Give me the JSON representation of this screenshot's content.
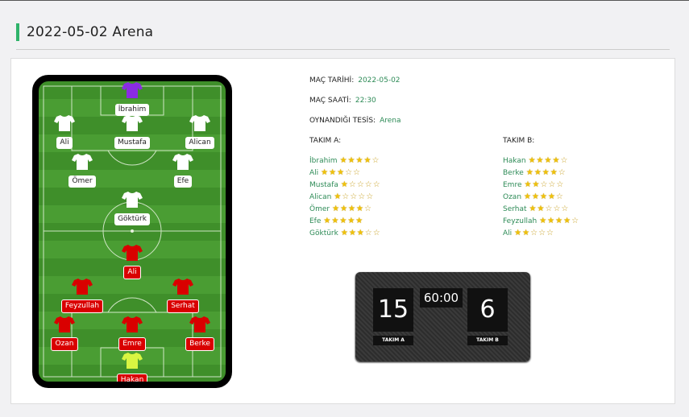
{
  "page": {
    "title": "2022-05-02 Arena"
  },
  "match": {
    "date_label": "MAÇ TARİHİ:",
    "date_value": "2022-05-02",
    "time_label": "MAÇ SAATİ:",
    "time_value": "22:30",
    "venue_label": "OYNANDIĞI TESİS:",
    "venue_value": "Arena"
  },
  "team_a": {
    "header": "TAKIM A:",
    "players": [
      {
        "name": "İbrahim",
        "rating": 4
      },
      {
        "name": "Ali",
        "rating": 3
      },
      {
        "name": "Mustafa",
        "rating": 1
      },
      {
        "name": "Alican",
        "rating": 1
      },
      {
        "name": "Ömer",
        "rating": 4
      },
      {
        "name": "Efe",
        "rating": 5
      },
      {
        "name": "Göktürk",
        "rating": 3
      }
    ]
  },
  "team_b": {
    "header": "TAKIM B:",
    "players": [
      {
        "name": "Hakan",
        "rating": 4
      },
      {
        "name": "Berke",
        "rating": 4
      },
      {
        "name": "Emre",
        "rating": 2
      },
      {
        "name": "Ozan",
        "rating": 4
      },
      {
        "name": "Serhat",
        "rating": 2
      },
      {
        "name": "Feyzullah",
        "rating": 4
      },
      {
        "name": "Ali",
        "rating": 2
      }
    ]
  },
  "pitch": {
    "top_players": [
      "İbrahim",
      "Ali",
      "Mustafa",
      "Alican",
      "Ömer",
      "Efe",
      "Göktürk"
    ],
    "bottom_players": [
      "Ali",
      "Feyzullah",
      "Serhat",
      "Ozan",
      "Emre",
      "Berke",
      "Hakan"
    ],
    "colors": {
      "gk_top": "#8a2be2",
      "outfield_top": "#ffffff",
      "outfield_bottom": "#d90000",
      "gk_bottom": "#d9f542"
    }
  },
  "scoreboard": {
    "score_a": "15",
    "score_b": "6",
    "clock": "60:00",
    "label_a": "TAKIM A",
    "label_b": "TAKIM B"
  }
}
